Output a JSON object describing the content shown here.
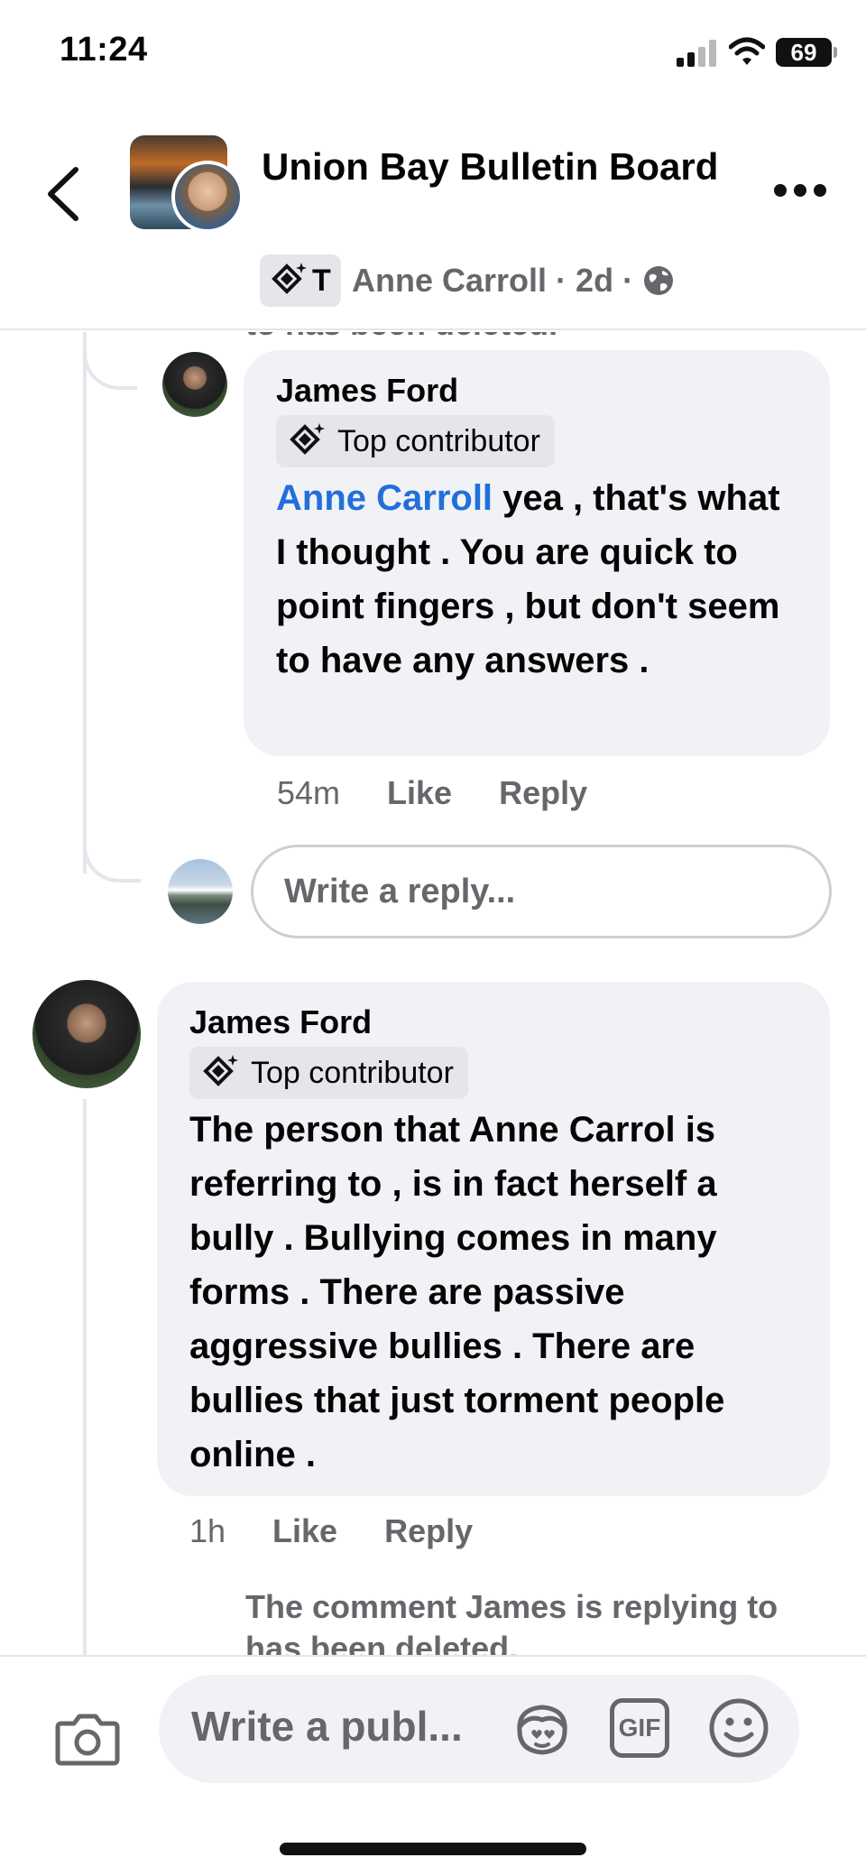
{
  "status_bar": {
    "time": "11:24",
    "battery": "69"
  },
  "header": {
    "group_name": "Union Bay Bulletin Board",
    "chip_letter": "T",
    "author": "Anne Carroll",
    "age": "2d",
    "separator": "·",
    "icons": [
      "back-chevron-icon",
      "more-dots-icon",
      "top-contributor-icon",
      "globe-icon"
    ]
  },
  "thread": {
    "cut_off_text": "to has been deleted.",
    "comments": [
      {
        "author": "James Ford",
        "badge": "Top contributor",
        "mention": "Anne Carroll",
        "text": " yea , that's what I thought .  You are quick to point fingers , but don't seem to have any answers .",
        "time": "54m",
        "like_label": "Like",
        "reply_label": "Reply"
      },
      {
        "author": "James Ford",
        "badge": "Top contributor",
        "text": "The person that Anne Carrol is referring to , is in fact herself a bully . Bullying comes in many forms . There are passive aggressive bullies . There are bullies that just torment people online .",
        "time": "1h",
        "like_label": "Like",
        "reply_label": "Reply"
      }
    ],
    "reply_placeholder": "Write a reply...",
    "deleted_note": "The comment James is replying to has been deleted."
  },
  "composer": {
    "placeholder": "Write a publ...",
    "gif_label": "GIF",
    "icons": [
      "camera-icon",
      "avatar-sticker-icon",
      "gif-icon",
      "emoji-icon"
    ]
  },
  "colors": {
    "mention": "#216fdb",
    "secondary_text": "#65676b",
    "bubble_bg": "#f0f2f5"
  }
}
